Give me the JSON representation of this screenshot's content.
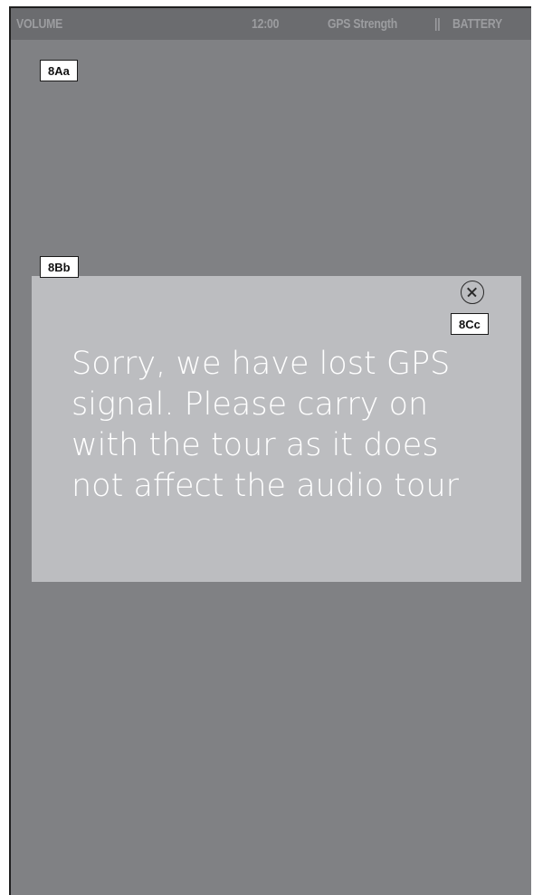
{
  "status_bar": {
    "volume": "VOLUME",
    "time": "12:00",
    "gps": "GPS Strength",
    "separator": "||",
    "battery": "BATTERY"
  },
  "annotations": {
    "screen_tag": "8Aa",
    "dialog_tag": "8Bb",
    "close_tag": "8Cc"
  },
  "dialog": {
    "message_lines": [
      "Sorry, we have lost GPS",
      "signal. Please carry on",
      "with the tour as it does",
      "not affect the audio tour"
    ],
    "close_icon": "close-circle-icon"
  },
  "colors": {
    "screen_bg": "#808184",
    "status_bar_bg": "#6b6c6f",
    "status_text": "#9c9da0",
    "dialog_bg": "#bcbdc0",
    "message_text": "#ffffff"
  }
}
